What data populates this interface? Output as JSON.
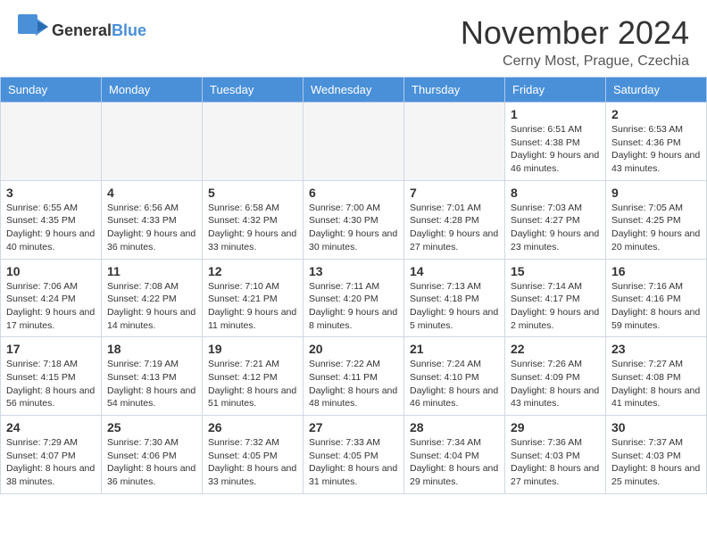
{
  "header": {
    "logo_general": "General",
    "logo_blue": "Blue",
    "month_title": "November 2024",
    "location": "Cerny Most, Prague, Czechia"
  },
  "calendar": {
    "headers": [
      "Sunday",
      "Monday",
      "Tuesday",
      "Wednesday",
      "Thursday",
      "Friday",
      "Saturday"
    ],
    "weeks": [
      [
        {
          "day": "",
          "info": "",
          "empty": true
        },
        {
          "day": "",
          "info": "",
          "empty": true
        },
        {
          "day": "",
          "info": "",
          "empty": true
        },
        {
          "day": "",
          "info": "",
          "empty": true
        },
        {
          "day": "",
          "info": "",
          "empty": true
        },
        {
          "day": "1",
          "info": "Sunrise: 6:51 AM\nSunset: 4:38 PM\nDaylight: 9 hours and 46 minutes."
        },
        {
          "day": "2",
          "info": "Sunrise: 6:53 AM\nSunset: 4:36 PM\nDaylight: 9 hours and 43 minutes."
        }
      ],
      [
        {
          "day": "3",
          "info": "Sunrise: 6:55 AM\nSunset: 4:35 PM\nDaylight: 9 hours and 40 minutes."
        },
        {
          "day": "4",
          "info": "Sunrise: 6:56 AM\nSunset: 4:33 PM\nDaylight: 9 hours and 36 minutes."
        },
        {
          "day": "5",
          "info": "Sunrise: 6:58 AM\nSunset: 4:32 PM\nDaylight: 9 hours and 33 minutes."
        },
        {
          "day": "6",
          "info": "Sunrise: 7:00 AM\nSunset: 4:30 PM\nDaylight: 9 hours and 30 minutes."
        },
        {
          "day": "7",
          "info": "Sunrise: 7:01 AM\nSunset: 4:28 PM\nDaylight: 9 hours and 27 minutes."
        },
        {
          "day": "8",
          "info": "Sunrise: 7:03 AM\nSunset: 4:27 PM\nDaylight: 9 hours and 23 minutes."
        },
        {
          "day": "9",
          "info": "Sunrise: 7:05 AM\nSunset: 4:25 PM\nDaylight: 9 hours and 20 minutes."
        }
      ],
      [
        {
          "day": "10",
          "info": "Sunrise: 7:06 AM\nSunset: 4:24 PM\nDaylight: 9 hours and 17 minutes."
        },
        {
          "day": "11",
          "info": "Sunrise: 7:08 AM\nSunset: 4:22 PM\nDaylight: 9 hours and 14 minutes."
        },
        {
          "day": "12",
          "info": "Sunrise: 7:10 AM\nSunset: 4:21 PM\nDaylight: 9 hours and 11 minutes."
        },
        {
          "day": "13",
          "info": "Sunrise: 7:11 AM\nSunset: 4:20 PM\nDaylight: 9 hours and 8 minutes."
        },
        {
          "day": "14",
          "info": "Sunrise: 7:13 AM\nSunset: 4:18 PM\nDaylight: 9 hours and 5 minutes."
        },
        {
          "day": "15",
          "info": "Sunrise: 7:14 AM\nSunset: 4:17 PM\nDaylight: 9 hours and 2 minutes."
        },
        {
          "day": "16",
          "info": "Sunrise: 7:16 AM\nSunset: 4:16 PM\nDaylight: 8 hours and 59 minutes."
        }
      ],
      [
        {
          "day": "17",
          "info": "Sunrise: 7:18 AM\nSunset: 4:15 PM\nDaylight: 8 hours and 56 minutes."
        },
        {
          "day": "18",
          "info": "Sunrise: 7:19 AM\nSunset: 4:13 PM\nDaylight: 8 hours and 54 minutes."
        },
        {
          "day": "19",
          "info": "Sunrise: 7:21 AM\nSunset: 4:12 PM\nDaylight: 8 hours and 51 minutes."
        },
        {
          "day": "20",
          "info": "Sunrise: 7:22 AM\nSunset: 4:11 PM\nDaylight: 8 hours and 48 minutes."
        },
        {
          "day": "21",
          "info": "Sunrise: 7:24 AM\nSunset: 4:10 PM\nDaylight: 8 hours and 46 minutes."
        },
        {
          "day": "22",
          "info": "Sunrise: 7:26 AM\nSunset: 4:09 PM\nDaylight: 8 hours and 43 minutes."
        },
        {
          "day": "23",
          "info": "Sunrise: 7:27 AM\nSunset: 4:08 PM\nDaylight: 8 hours and 41 minutes."
        }
      ],
      [
        {
          "day": "24",
          "info": "Sunrise: 7:29 AM\nSunset: 4:07 PM\nDaylight: 8 hours and 38 minutes."
        },
        {
          "day": "25",
          "info": "Sunrise: 7:30 AM\nSunset: 4:06 PM\nDaylight: 8 hours and 36 minutes."
        },
        {
          "day": "26",
          "info": "Sunrise: 7:32 AM\nSunset: 4:05 PM\nDaylight: 8 hours and 33 minutes."
        },
        {
          "day": "27",
          "info": "Sunrise: 7:33 AM\nSunset: 4:05 PM\nDaylight: 8 hours and 31 minutes."
        },
        {
          "day": "28",
          "info": "Sunrise: 7:34 AM\nSunset: 4:04 PM\nDaylight: 8 hours and 29 minutes."
        },
        {
          "day": "29",
          "info": "Sunrise: 7:36 AM\nSunset: 4:03 PM\nDaylight: 8 hours and 27 minutes."
        },
        {
          "day": "30",
          "info": "Sunrise: 7:37 AM\nSunset: 4:03 PM\nDaylight: 8 hours and 25 minutes."
        }
      ]
    ]
  }
}
